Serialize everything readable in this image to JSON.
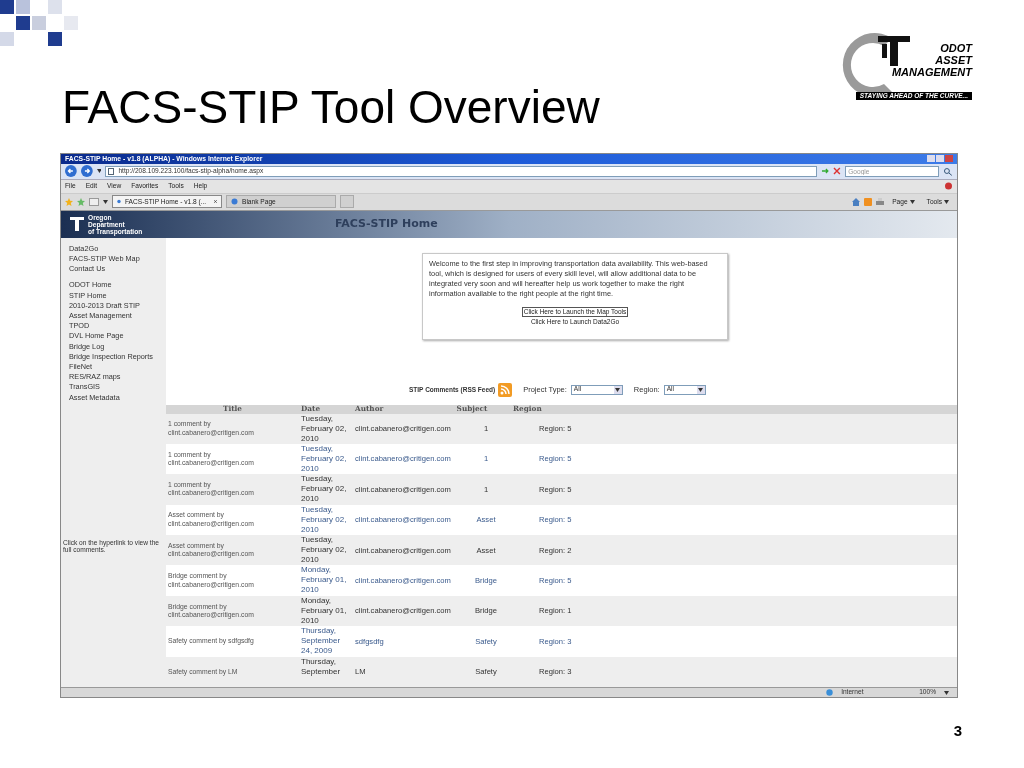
{
  "slide": {
    "title": "FACS-STIP Tool Overview",
    "number": "3",
    "logo": {
      "lines": [
        "ODOT",
        "ASSET",
        "MANAGEMENT"
      ],
      "tagline": "STAYING AHEAD OF THE CURVE..."
    }
  },
  "browser": {
    "title": "FACS-STIP Home - v1.8 (ALPHA) - Windows Internet Explorer",
    "url": "http://208.109.223.100/facs-stip-alpha/home.aspx",
    "search": {
      "placeholder": "Google"
    },
    "menu": [
      "File",
      "Edit",
      "View",
      "Favorites",
      "Tools",
      "Help"
    ],
    "tabs": [
      {
        "label": "FACS-STIP Home - v1.8 (...",
        "selected": true
      },
      {
        "label": "Blank Page",
        "selected": false
      }
    ],
    "toolbar": [
      "Page",
      "Tools"
    ],
    "status_bar": {
      "zone": "Internet",
      "zoom": "100%"
    }
  },
  "page": {
    "agency": [
      "Oregon",
      "Department",
      "of Transportation"
    ],
    "heading": "FACS-STIP Home",
    "sidebar": {
      "groups": [
        [
          "Data2Go",
          "FACS-STIP Web Map",
          "Contact Us"
        ],
        [
          "ODOT Home",
          "STIP Home",
          "2010-2013 Draft STIP",
          "Asset Management",
          "TPOD",
          "DVL Home Page",
          "Bridge Log",
          "Bridge Inspection Reports",
          "FileNet",
          "RES/RAZ maps",
          "TransGIS",
          "Asset Metadata"
        ]
      ],
      "note": "Click on the hyperlink to view the full comments."
    },
    "welcome": {
      "text": "Welcome to the first step in improving transportation data availability. This web-based tool, which is designed for users of every skill level, will allow additional data to be integrated very soon and will hereafter help us work together to make the right information available to the right people at the right time.",
      "links": [
        {
          "label": "Click Here to Launch the Map Tools",
          "focused": true
        },
        {
          "label": "Click Here to Launch Data2Go",
          "focused": false
        }
      ]
    },
    "comments": {
      "label": "STIP Comments (RSS Feed)",
      "filters": [
        {
          "label": "Project Type:",
          "value": "All"
        },
        {
          "label": "Region:",
          "value": "All"
        }
      ],
      "table": {
        "columns": [
          "Title",
          "Date",
          "Author",
          "Subject",
          "Region"
        ],
        "rows": [
          {
            "title": "1 comment by clint.cabanero@critigen.com",
            "date": "Tuesday, February 02, 2010",
            "author": "clint.cabanero@critigen.com",
            "subject": "1",
            "region": "Region: 5"
          },
          {
            "title": "1 comment by clint.cabanero@critigen.com",
            "date": "Tuesday, February 02, 2010",
            "author": "clint.cabanero@critigen.com",
            "subject": "1",
            "region": "Region: 5"
          },
          {
            "title": "1 comment by clint.cabanero@critigen.com",
            "date": "Tuesday, February 02, 2010",
            "author": "clint.cabanero@critigen.com",
            "subject": "1",
            "region": "Region: 5"
          },
          {
            "title": "Asset comment by clint.cabanero@critigen.com",
            "date": "Tuesday, February 02, 2010",
            "author": "clint.cabanero@critigen.com",
            "subject": "Asset",
            "region": "Region: 5"
          },
          {
            "title": "Asset comment by clint.cabanero@critigen.com",
            "date": "Tuesday, February 02, 2010",
            "author": "clint.cabanero@critigen.com",
            "subject": "Asset",
            "region": "Region: 2"
          },
          {
            "title": "Bridge comment by clint.cabanero@critigen.com",
            "date": "Monday, February 01, 2010",
            "author": "clint.cabanero@critigen.com",
            "subject": "Bridge",
            "region": "Region: 5"
          },
          {
            "title": "Bridge comment by clint.cabanero@critigen.com",
            "date": "Monday, February 01, 2010",
            "author": "clint.cabanero@critigen.com",
            "subject": "Bridge",
            "region": "Region: 1"
          },
          {
            "title": "Safety comment by sdfgsdfg",
            "date": "Thursday, September 24, 2009",
            "author": "sdfgsdfg",
            "subject": "Safety",
            "region": "Region: 3"
          },
          {
            "title": "Safety comment by LM",
            "date": "Thursday, September",
            "author": "LM",
            "subject": "Safety",
            "region": "Region: 3"
          }
        ]
      }
    }
  }
}
